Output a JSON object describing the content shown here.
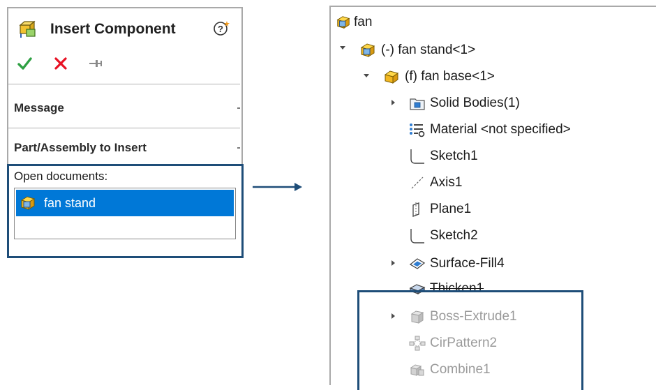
{
  "colors": {
    "accent": "#1e4d78",
    "selection": "#0078d7",
    "ok": "#2ea043",
    "cancel": "#e81123"
  },
  "panel": {
    "title": "Insert Component",
    "sections": {
      "message": "Message",
      "part_assembly": "Part/Assembly to Insert"
    },
    "open_docs_label": "Open documents:",
    "documents": [
      {
        "name": "fan stand",
        "icon": "assembly-icon",
        "selected": true
      }
    ]
  },
  "tree": {
    "root": "fan",
    "items": [
      {
        "label": "(-) fan stand<1>",
        "icon": "assembly-icon",
        "expander": "expanded"
      },
      {
        "label": "(f) fan base<1>",
        "icon": "part-icon",
        "expander": "expanded"
      },
      {
        "label": "Solid Bodies(1)",
        "icon": "solid-bodies-folder-icon",
        "expander": "collapsed"
      },
      {
        "label": "Material <not specified>",
        "icon": "material-icon"
      },
      {
        "label": "Sketch1",
        "icon": "sketch-icon"
      },
      {
        "label": "Axis1",
        "icon": "axis-icon"
      },
      {
        "label": "Plane1",
        "icon": "plane-icon"
      },
      {
        "label": "Sketch2",
        "icon": "sketch-icon"
      },
      {
        "label": "Surface-Fill4",
        "icon": "surface-fill-icon",
        "expander": "collapsed"
      },
      {
        "label": "Thicken1",
        "icon": "thicken-icon"
      },
      {
        "label": "Boss-Extrude1",
        "icon": "boss-extrude-icon",
        "expander": "collapsed",
        "state": "suppressed"
      },
      {
        "label": "CirPattern2",
        "icon": "circular-pattern-icon",
        "state": "suppressed"
      },
      {
        "label": "Combine1",
        "icon": "combine-icon",
        "state": "suppressed"
      }
    ]
  }
}
